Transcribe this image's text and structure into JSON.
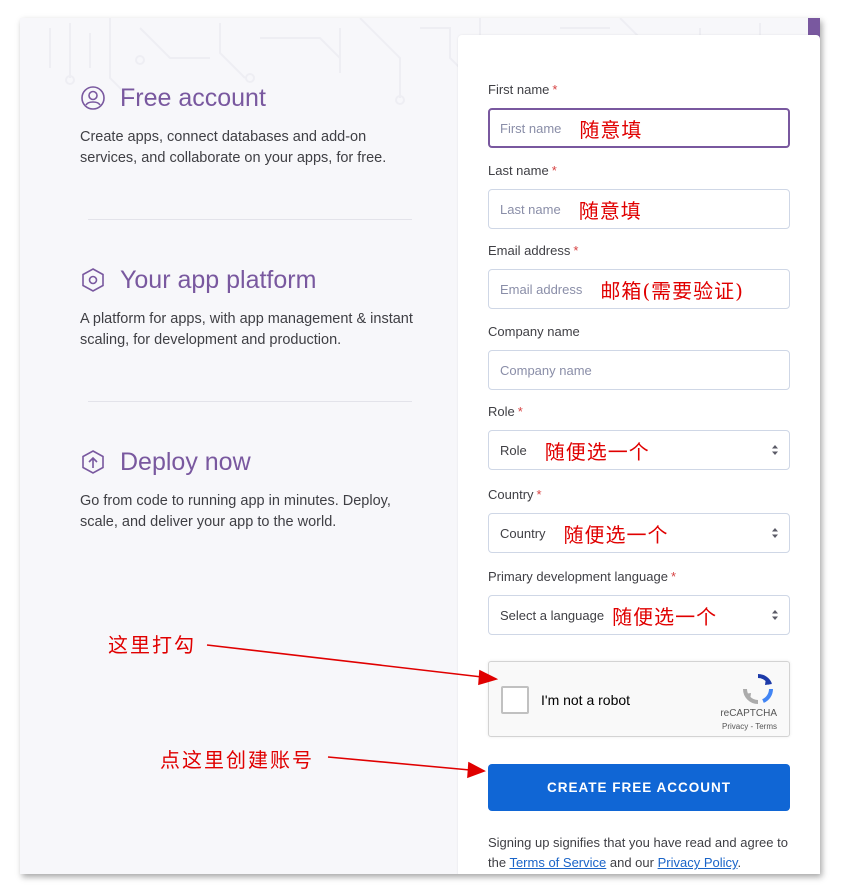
{
  "features": [
    {
      "icon": "user-circle-icon",
      "title": "Free account",
      "desc": "Create apps, connect databases and add-on services, and collaborate on your apps, for free."
    },
    {
      "icon": "hexagon-icon",
      "title": "Your app platform",
      "desc": "A platform for apps, with app management & instant scaling, for development and production."
    },
    {
      "icon": "upload-arrow-icon",
      "title": "Deploy now",
      "desc": "Go from code to running app in minutes. Deploy, scale, and deliver your app to the world."
    }
  ],
  "form": {
    "first_name": {
      "label": "First name",
      "required": "*",
      "placeholder": "First name",
      "annotation": "随意填"
    },
    "last_name": {
      "label": "Last name",
      "required": "*",
      "placeholder": "Last name",
      "annotation": "随意填"
    },
    "email": {
      "label": "Email address",
      "required": "*",
      "placeholder": "Email address",
      "annotation": "邮箱(需要验证)"
    },
    "company": {
      "label": "Company name",
      "placeholder": "Company name"
    },
    "role": {
      "label": "Role",
      "required": "*",
      "value": "Role",
      "annotation": "随便选一个"
    },
    "country": {
      "label": "Country",
      "required": "*",
      "value": "Country",
      "annotation": "随便选一个"
    },
    "language": {
      "label": "Primary development language",
      "required": "*",
      "value": "Select a language",
      "annotation": "随便选一个"
    }
  },
  "captcha": {
    "label": "I'm not a robot",
    "brand": "reCAPTCHA",
    "links": "Privacy - Terms"
  },
  "create_button": "CREATE FREE ACCOUNT",
  "legal": {
    "prefix": "Signing up signifies that you have read and agree to the ",
    "terms": "Terms of Service",
    "middle": " and our ",
    "privacy": "Privacy Policy",
    "suffix": "."
  },
  "callouts": {
    "checkbox": "这里打勾",
    "create": "点这里创建账号"
  },
  "colors": {
    "brand_purple": "#79589f",
    "button_blue": "#1066d5",
    "annotation_red": "#e00000",
    "required_red": "#d64242"
  }
}
